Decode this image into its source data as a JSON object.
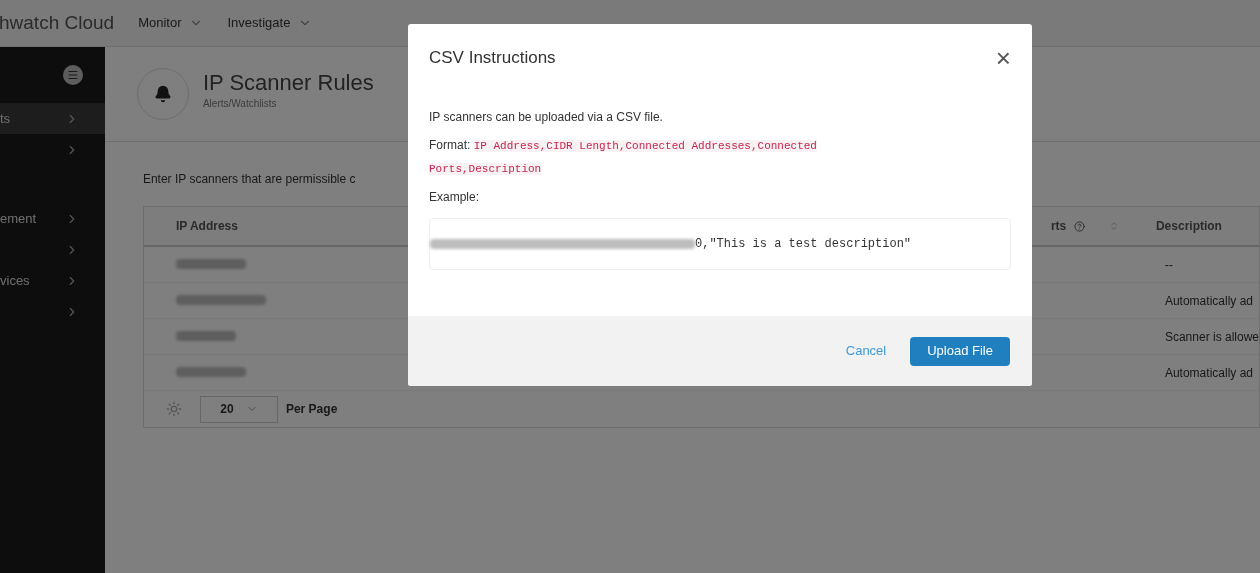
{
  "topbar": {
    "brand": "hwatch Cloud",
    "menus": [
      {
        "label": "Monitor"
      },
      {
        "label": "Investigate"
      }
    ]
  },
  "sidebar": {
    "items": [
      {
        "label": "ts",
        "selected": true
      },
      {
        "selected": false
      },
      {
        "label": "ement",
        "selected": false
      },
      {
        "selected": false
      },
      {
        "label": "vices",
        "selected": false
      },
      {
        "selected": false
      }
    ]
  },
  "page": {
    "title": "IP Scanner Rules",
    "breadcrumb": "Alerts/Watchlists",
    "intro": "Enter IP scanners that are permissible c"
  },
  "table": {
    "columns": [
      {
        "label": "IP Address"
      },
      {
        "label": "rts"
      },
      {
        "label": "Description"
      }
    ],
    "rows": [
      {
        "description": "--"
      },
      {
        "description": "Automatically ad"
      },
      {
        "description": "Scanner is allowe"
      },
      {
        "description": "Automatically ad"
      }
    ],
    "footer": {
      "page_size": "20",
      "per_page": "Per Page"
    }
  },
  "modal": {
    "title": "CSV Instructions",
    "close": "×",
    "line": "IP scanners can be uploaded via a CSV file.",
    "format_label": "Format:",
    "format": "IP Address,CIDR Length,Connected Addresses,Connected Ports,Description",
    "example_label": "Example:",
    "example": "0,\"This is a test description\"",
    "buttons": [
      {
        "label": "Cancel",
        "kind": "link"
      },
      {
        "label": "Upload File",
        "kind": "primary"
      }
    ]
  }
}
